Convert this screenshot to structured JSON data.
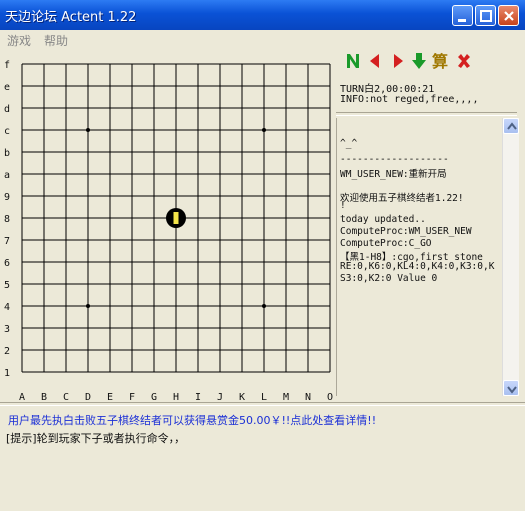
{
  "window": {
    "title": "天边论坛 Actent 1.22"
  },
  "menu": {
    "items": [
      {
        "label": "游戏"
      },
      {
        "label": "帮助"
      }
    ]
  },
  "board": {
    "rows": [
      "f",
      "e",
      "d",
      "c",
      "b",
      "a",
      "9",
      "8",
      "7",
      "6",
      "5",
      "4",
      "3",
      "2",
      "1"
    ],
    "cols": [
      "A",
      "B",
      "C",
      "D",
      "E",
      "F",
      "G",
      "H",
      "I",
      "J",
      "K",
      "L",
      "M",
      "N",
      "O"
    ],
    "star_points": [
      [
        "D",
        "c"
      ],
      [
        "L",
        "c"
      ],
      [
        "D",
        "4"
      ],
      [
        "L",
        "4"
      ]
    ],
    "stones": [
      {
        "col": "H",
        "row": "8",
        "color": "black",
        "last_move": true
      }
    ],
    "colors": {
      "grid": "#000000",
      "stone": "#000000",
      "last_move_marker": "#f2e44a"
    }
  },
  "toolbar": {
    "items": [
      {
        "icon": "new-game-icon",
        "glyph": "N",
        "color": "#1a9a2a"
      },
      {
        "icon": "back-arrow-icon",
        "color": "#d42020"
      },
      {
        "icon": "forward-arrow-icon",
        "color": "#d42020"
      },
      {
        "icon": "down-arrow-icon",
        "color": "#1a9a2a"
      },
      {
        "icon": "compute-icon",
        "glyph": "算",
        "color": "#a07800"
      },
      {
        "icon": "exit-x-icon",
        "color": "#d42020"
      }
    ]
  },
  "info": {
    "turn": "TURN白2,00:00:21",
    "status": "INFO:not reged,free,,,,"
  },
  "log": {
    "lines": [
      "^_^",
      "-------------------",
      "WM_USER_NEW:重新开局",
      "",
      "欢迎使用五子棋终结者1.22!",
      "!",
      "today updated..",
      "ComputeProc:WM_USER_NEW",
      "ComputeProc:C_GO",
      "【黑1-H8】:cgo,first stone",
      "RE:0,K6:0,KL4:0,K4:0,K3:0,K",
      "S3:0,K2:0 Value 0"
    ]
  },
  "promo": {
    "text": "用户最先执白击败五子棋终结者可以获得悬赏金50.00￥!!点此处查看详情!!"
  },
  "hint": {
    "text": "[提示]轮到玩家下子或者执行命令，，"
  }
}
